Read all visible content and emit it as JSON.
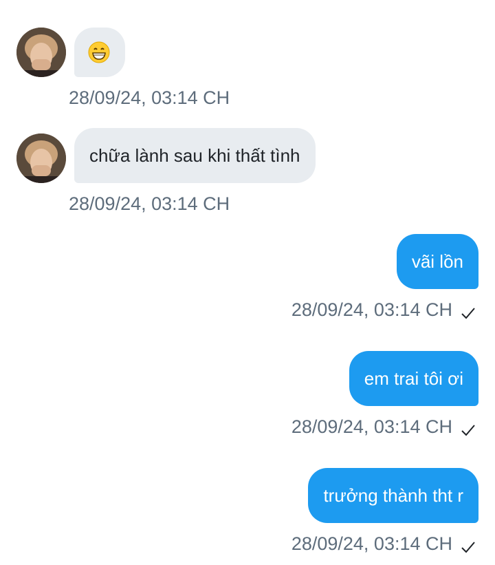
{
  "conversation": {
    "messages": [
      {
        "direction": "incoming",
        "text": "😁",
        "timestamp": "28/09/24, 03:14 CH",
        "content_icon": "grinning-face-emoji-icon"
      },
      {
        "direction": "incoming",
        "text": "chữa lành sau khi thất tình",
        "timestamp": "28/09/24, 03:14 CH"
      },
      {
        "direction": "outgoing",
        "text": "vãi lồn",
        "timestamp": "28/09/24, 03:14 CH",
        "status_icon": "checkmark-icon"
      },
      {
        "direction": "outgoing",
        "text": "em trai tôi ơi",
        "timestamp": "28/09/24, 03:14 CH",
        "status_icon": "checkmark-icon"
      },
      {
        "direction": "outgoing",
        "text": "trưởng thành tht r",
        "timestamp": "28/09/24, 03:14 CH",
        "status_icon": "checkmark-icon"
      }
    ]
  },
  "colors": {
    "incoming_bubble": "#e8ecf0",
    "outgoing_bubble": "#1d9bf0",
    "timestamp_text": "#5d6c7b",
    "incoming_text": "#1f2328",
    "outgoing_text": "#ffffff"
  }
}
